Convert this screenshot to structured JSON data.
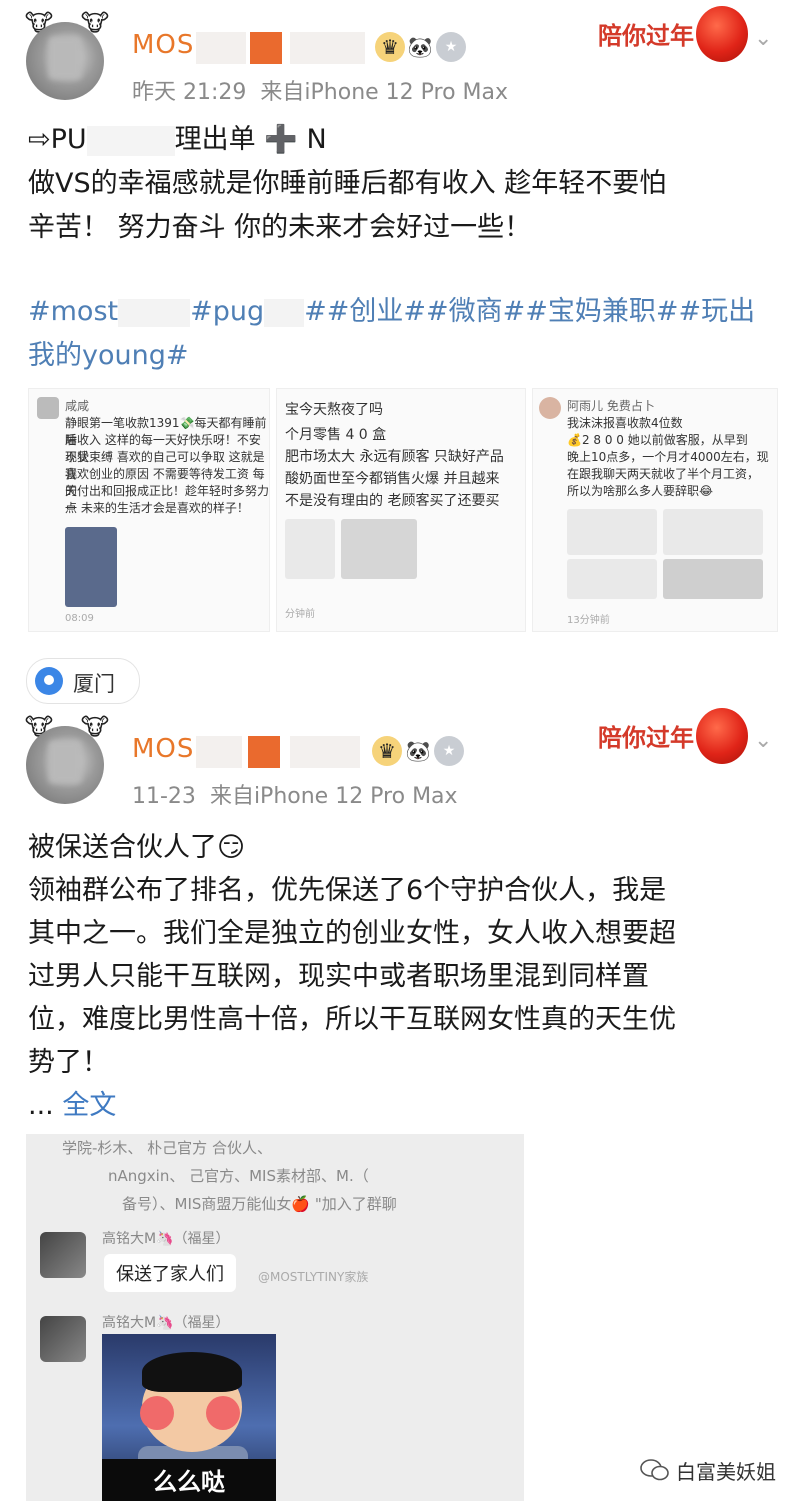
{
  "posts": [
    {
      "username": "MOS",
      "timestamp": "昨天 21:29",
      "source": "来自iPhone 12 Pro Max",
      "festival_label": "陪你过年",
      "lines": [
        "⇨PU",
        "理出单",
        "➕ N"
      ],
      "body_line_2": "做VS的幸福感就是你睡前睡后都有收入  趁年轻不要怕",
      "body_line_3": "辛苦！ 努力奋斗 你的未来才会好过一些！",
      "tags": [
        "#most",
        "#pug",
        "##创业##微商##宝妈兼职##玩出",
        "我的young#"
      ],
      "thumbs": [
        {
          "name": "咸咸",
          "lines": [
            "静眼第一笔收款1391💸每天都有睡前睡",
            "后收入 这样的每一天好快乐呀！不安现状",
            "不受束缚 喜欢的自己可以争取 这就是我",
            "喜欢创业的原因 不需要等待发工资 每天",
            "的付出和回报成正比！趁年轻时多努力一",
            "点 未来的生活才会是喜欢的样子！"
          ],
          "time": "08:09"
        },
        {
          "name": "宝今天熬夜了吗",
          "lines": [
            "个月零售 4 0 盒",
            "肥市场太大 永远有顾客 只缺好产品",
            "酸奶面世至今都销售火爆 并且越来",
            "不是没有理由的 老顾客买了还要买"
          ],
          "time": "分钟前"
        },
        {
          "name": "阿雨儿 免费占卜",
          "lines": [
            "我沫沫报喜收款4位数",
            "💰2 8 0 0 她以前做客服，从早到",
            "晚上10点多，一个月才4000左右，现",
            "在跟我聊天两天就收了半个月工资，",
            "所以为啥那么多人要辞职😂"
          ],
          "time": "13分钟前"
        }
      ],
      "location": "厦门"
    },
    {
      "username": "MOS",
      "timestamp": "11-23",
      "source": "来自iPhone 12 Pro Max",
      "festival_label": "陪你过年",
      "lines": [
        "被保送合伙人了😏",
        "领袖群公布了排名，优先保送了6个守护合伙人，我是",
        "其中之一。我们全是独立的创业女性，女人收入想要超",
        "过男人只能干互联网，现实中或者职场里混到同样置",
        "位，难度比男性高十倍，所以干互联网女性真的天生优",
        "势了！"
      ],
      "ellipsis": "...",
      "full_text_link": "全文",
      "chat": {
        "sys_line_1": "学院-杉木、       朴己官方         合伙人、",
        "sys_line_2": "       nAngxin、       己官方、MIS素材部、M.（",
        "sys_line_3": "备号）、MIS商盟万能仙女🍎 \"加入了群聊",
        "sender_name": "高铭大M🦄（福星）",
        "bubble": "保送了家人们",
        "watermark": "@MOSTLYTINY家族",
        "sticker_caption": "么么哒"
      }
    }
  ],
  "watermark_label": "白富美妖姐"
}
